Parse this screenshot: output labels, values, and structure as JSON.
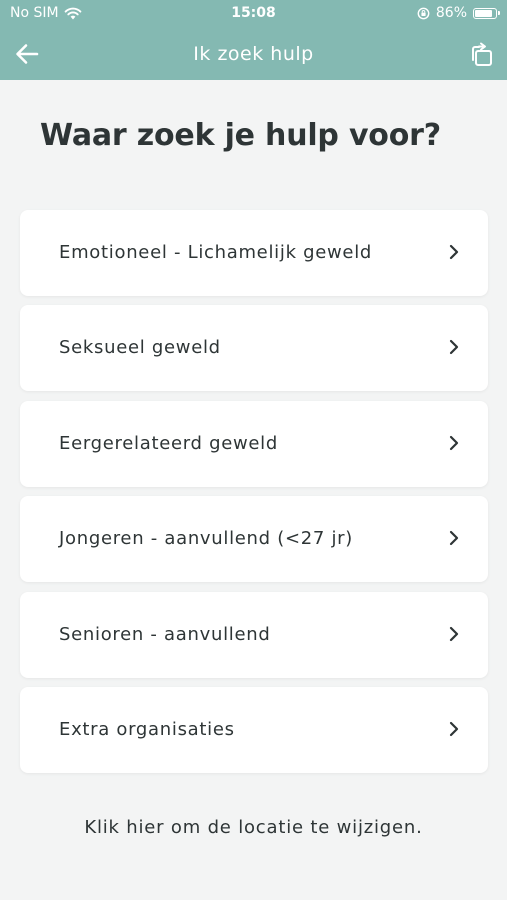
{
  "status_bar": {
    "carrier": "No SIM",
    "time": "15:08",
    "battery_percent": "86%",
    "battery_level": 0.86,
    "icons": [
      "wifi-icon",
      "orientation-lock-icon",
      "battery-icon"
    ]
  },
  "navbar": {
    "title": "Ik zoek hulp",
    "back_icon": "arrow-left-icon",
    "action_icon": "share-icon",
    "color": "#84b9b2"
  },
  "page": {
    "heading": "Waar zoek je hulp voor?"
  },
  "menu": {
    "items": [
      {
        "label": "Emotioneel - Lichamelijk geweld"
      },
      {
        "label": "Seksueel geweld"
      },
      {
        "label": "Eergerelateerd geweld"
      },
      {
        "label": "Jongeren - aanvullend (<27 jr)"
      },
      {
        "label": "Senioren - aanvullend"
      },
      {
        "label": "Extra organisaties"
      }
    ],
    "chevron_icon": "chevron-right-icon"
  },
  "footer": {
    "link_text": "Klik hier om de locatie te wijzigen."
  }
}
